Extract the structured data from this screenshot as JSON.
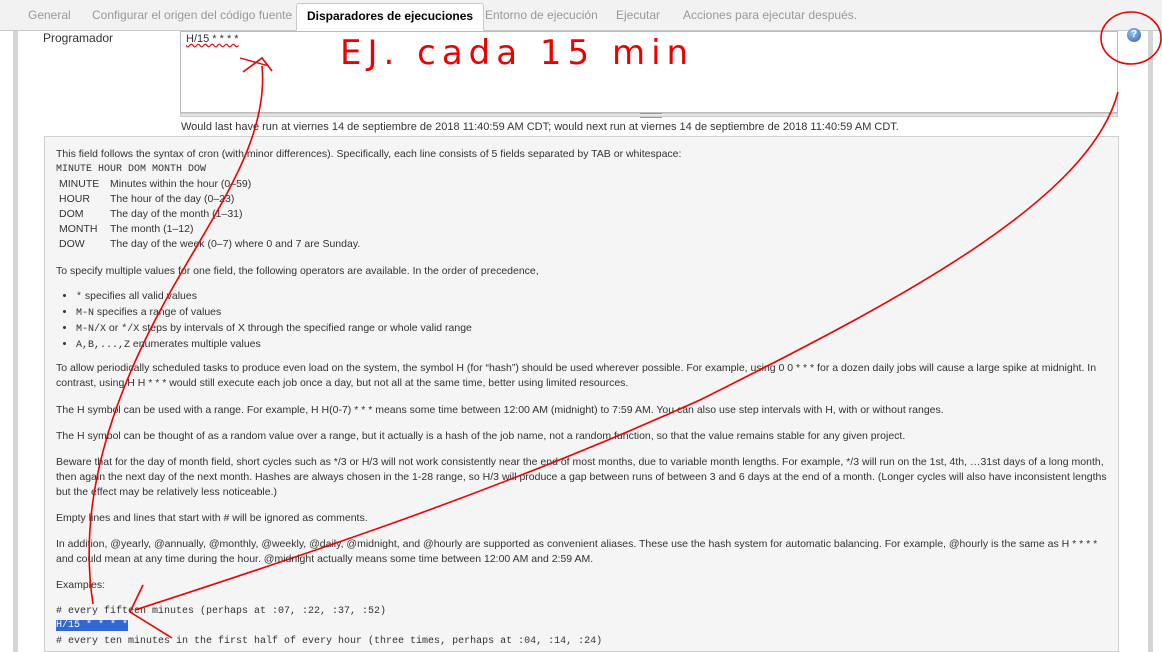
{
  "tabs": [
    {
      "label": "General",
      "active": false
    },
    {
      "label": "Configurar el origen del código fuente",
      "active": false
    },
    {
      "label": "Disparadores de ejecuciones",
      "active": true
    },
    {
      "label": "Entorno de ejecución",
      "active": false
    },
    {
      "label": "Ejecutar",
      "active": false
    },
    {
      "label": "Acciones para ejecutar después.",
      "active": false
    }
  ],
  "scheduler": {
    "label": "Programador",
    "value": "H/15 * * * *",
    "status": "Would last have run at viernes 14 de septiembre de 2018 11:40:59 AM CDT; would next run at viernes 14 de septiembre de 2018 11:40:59 AM CDT."
  },
  "help": {
    "intro": "This field follows the syntax of cron (with minor differences). Specifically, each line consists of 5 fields separated by TAB or whitespace:",
    "format_line": "MINUTE HOUR DOM MONTH DOW",
    "fields": [
      {
        "name": "MINUTE",
        "desc": "Minutes within the hour (0–59)"
      },
      {
        "name": "HOUR",
        "desc": "The hour of the day (0–23)"
      },
      {
        "name": "DOM",
        "desc": "The day of the month (1–31)"
      },
      {
        "name": "MONTH",
        "desc": "The month (1–12)"
      },
      {
        "name": "DOW",
        "desc": "The day of the week (0–7) where 0 and 7 are Sunday."
      }
    ],
    "operators_intro": "To specify multiple values for one field, the following operators are available. In the order of precedence,",
    "operators": [
      {
        "code": "*",
        "text": " specifies all valid values"
      },
      {
        "code": "M-N",
        "text": " specifies a range of values"
      },
      {
        "code": "M-N/X",
        "text": " or ",
        "code2": "*/X",
        "text2": " steps by intervals of X through the specified range or whole valid range"
      },
      {
        "code": "A,B,...,Z",
        "text": " enumerates multiple values"
      }
    ],
    "p_hash": "To allow periodically scheduled tasks to produce even load on the system, the symbol H (for “hash”) should be used wherever possible. For example, using 0 0 * * * for a dozen daily jobs will cause a large spike at midnight. In contrast, using H H * * * would still execute each job once a day, but not all at the same time, better using limited resources.",
    "p_range": "The H symbol can be used with a range. For example, H H(0-7) * * * means some time between 12:00 AM (midnight) to 7:59 AM. You can also use step intervals with H, with or without ranges.",
    "p_random": "The H symbol can be thought of as a random value over a range, but it actually is a hash of the job name, not a random function, so that the value remains stable for any given project.",
    "p_beware": "Beware that for the day of month field, short cycles such as */3 or H/3 will not work consistently near the end of most months, due to variable month lengths. For example, */3 will run on the 1st, 4th, …31st days of a long month, then again the next day of the next month. Hashes are always chosen in the 1-28 range, so H/3 will produce a gap between runs of between 3 and 6 days at the end of a month. (Longer cycles will also have inconsistent lengths but the effect may be relatively less noticeable.)",
    "p_empty": "Empty lines and lines that start with # will be ignored as comments.",
    "p_aliases": "In addition, @yearly, @annually, @monthly, @weekly, @daily, @midnight, and @hourly are supported as convenient aliases. These use the hash system for automatic balancing. For example, @hourly is the same as H * * * * and could mean at any time during the hour. @midnight actually means some time between 12:00 AM and 2:59 AM.",
    "examples_label": "Examples:",
    "ex1_comment": "# every fifteen minutes (perhaps at :07, :22, :37, :52)",
    "ex1_code": "H/15 * * * *",
    "ex2_comment": "# every ten minutes in the first half of every hour (three times, perhaps at :04, :14, :24)"
  },
  "annotation": {
    "text": "EJ. cada 15 min",
    "color": "#e00000"
  },
  "icons": {
    "help": "question-help-icon"
  }
}
